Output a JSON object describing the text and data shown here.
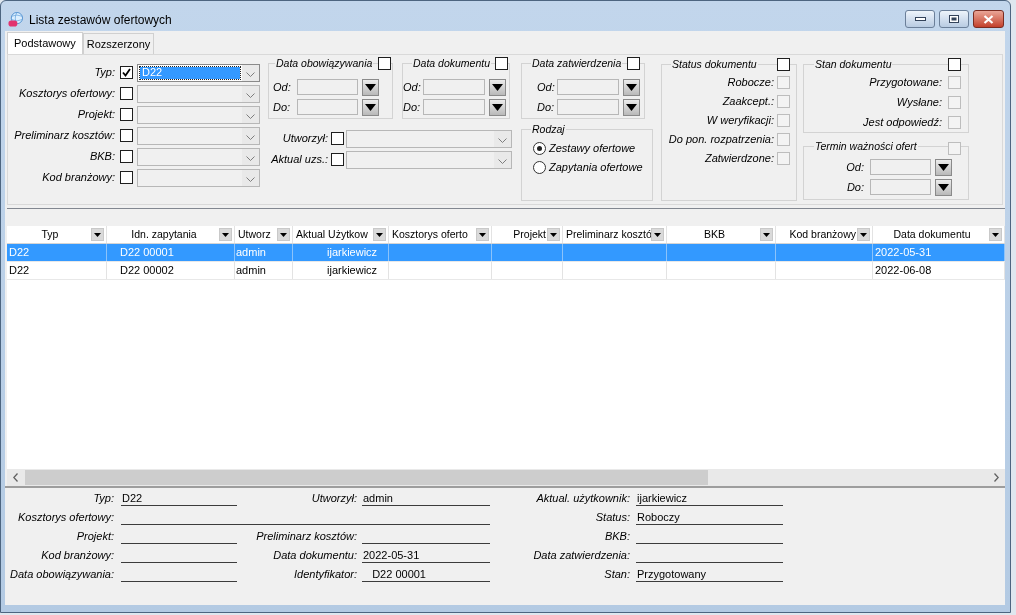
{
  "window": {
    "title": "Lista zestawów ofertowych"
  },
  "tabs": [
    {
      "label": "Podstawowy",
      "selected": true
    },
    {
      "label": "Rozszerzony",
      "selected": false
    }
  ],
  "filters": {
    "fields": [
      {
        "label": "Typ:",
        "checked": true,
        "focused": true,
        "value": "D22"
      },
      {
        "label": "Kosztorys ofertowy:",
        "checked": false,
        "focused": false
      },
      {
        "label": "Projekt:",
        "checked": false,
        "focused": false
      },
      {
        "label": "Preliminarz kosztów:",
        "checked": false,
        "focused": false
      },
      {
        "label": "BKB:",
        "checked": false,
        "focused": false
      },
      {
        "label": "Kod branżowy:",
        "checked": false,
        "focused": false
      }
    ],
    "date_ranges": [
      {
        "title": "Data obowiązywania",
        "checked": false,
        "from_label": "Od:",
        "to_label": "Do:"
      },
      {
        "title": "Data dokumentu",
        "checked": false,
        "from_label": "Od:",
        "to_label": "Do:"
      },
      {
        "title": "Data zatwierdzenia",
        "checked": false,
        "from_label": "Od:",
        "to_label": "Do:"
      }
    ],
    "user_fields": [
      {
        "label": "Utworzył:",
        "checked": false
      },
      {
        "label": "Aktual uzs.:",
        "checked": false
      }
    ],
    "rodzaj": {
      "title": "Rodzaj",
      "options": [
        {
          "label": "Zestawy ofertowe",
          "selected": true
        },
        {
          "label": "Zapytania ofertowe",
          "selected": false
        }
      ]
    },
    "status_dokumentu": {
      "title": "Status dokumentu",
      "checked": false,
      "disabled": false,
      "items": [
        {
          "label": "Robocze:",
          "checked": false,
          "disabled": true
        },
        {
          "label": "Zaakcept.:",
          "checked": false,
          "disabled": true
        },
        {
          "label": "W weryfikacji:",
          "checked": false,
          "disabled": true
        },
        {
          "label": "Do pon. rozpatrzenia:",
          "checked": false,
          "disabled": true
        },
        {
          "label": "Zatwierdzone:",
          "checked": false,
          "disabled": true
        }
      ]
    },
    "stan_dokumentu": {
      "title": "Stan dokumentu",
      "checked": false,
      "disabled": false,
      "items": [
        {
          "label": "Przygotowane:",
          "checked": false,
          "disabled": true
        },
        {
          "label": "Wysłane:",
          "checked": false,
          "disabled": true
        },
        {
          "label": "Jest odpowiedź:",
          "checked": false,
          "disabled": true
        }
      ]
    },
    "termin_waznosci": {
      "title": "Termin ważności ofert",
      "checked": false,
      "disabled": true,
      "from_label": "Od:",
      "to_label": "Do:"
    }
  },
  "table": {
    "columns": [
      "Typ",
      "Idn. zapytania",
      "Utworz",
      "Aktual Użytkow",
      "Kosztorys oferto",
      "Projekt",
      "Preliminarz kosztó",
      "BKB",
      "Kod branżowy",
      "Data dokumentu"
    ],
    "rows": [
      {
        "selected": true,
        "typ": "D22",
        "idn_zapytania": "D22 00001",
        "column_3": "admin",
        "column_4": "ijarkiewicz",
        "data_dokumentu": "2022-05-31"
      },
      {
        "selected": false,
        "typ": "D22",
        "idn_zapytania": "D22 00002",
        "column_3": "admin",
        "column_4": "ijarkiewicz",
        "data_dokumentu": "2022-06-08"
      }
    ]
  },
  "details": {
    "rows": [
      {
        "items": [
          {
            "kind": "field",
            "label": "Typ:",
            "value": "D22"
          },
          {
            "kind": "field",
            "label": "Utworzył:",
            "value": "admin"
          },
          {
            "kind": "field",
            "label": "Aktual. użytkownik:",
            "value": "ijarkiewicz"
          }
        ]
      },
      {
        "items": [
          {
            "kind": "wide",
            "label": "Kosztorys ofertowy:"
          },
          {
            "kind": "field",
            "label": "Status:",
            "value": "Roboczy"
          }
        ]
      },
      {
        "items": [
          {
            "kind": "field",
            "label": "Projekt:"
          },
          {
            "kind": "field",
            "label": "Preliminarz kosztów:"
          },
          {
            "kind": "field",
            "label": "BKB:"
          }
        ]
      },
      {
        "items": [
          {
            "kind": "field",
            "label": "Kod branżowy:"
          },
          {
            "kind": "field",
            "label": "Data dokumentu:",
            "value": "2022-05-31"
          },
          {
            "kind": "field",
            "label": "Data zatwierdzenia:"
          }
        ]
      },
      {
        "items": [
          {
            "kind": "field",
            "label": "Data obowiązywania:"
          },
          {
            "kind": "field",
            "label": "Identyfikator:",
            "value": "   D22 00001"
          },
          {
            "kind": "field",
            "label": "Stan:",
            "value": "Przygotowany"
          }
        ]
      }
    ]
  }
}
